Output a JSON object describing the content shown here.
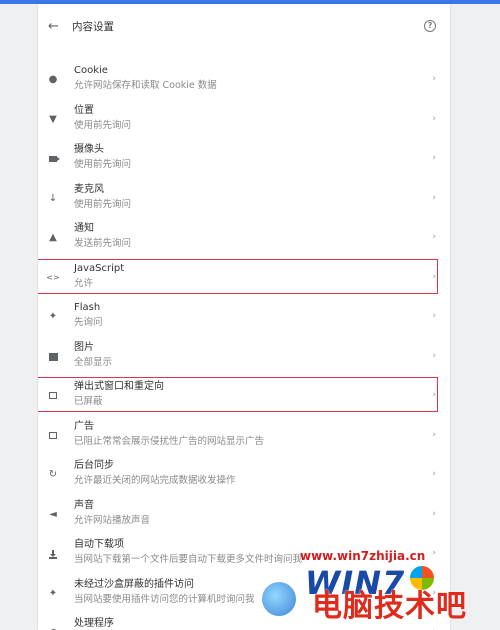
{
  "header": {
    "title": "内容设置",
    "back_icon": "arrow-left-icon",
    "help_icon": "help-circle-icon"
  },
  "items": [
    {
      "title": "Cookie",
      "sub": "允许网站保存和读取 Cookie 数据",
      "icon": "cookie-icon"
    },
    {
      "title": "位置",
      "sub": "使用前先询问",
      "icon": "location-icon"
    },
    {
      "title": "摄像头",
      "sub": "使用前先询问",
      "icon": "camera-icon"
    },
    {
      "title": "麦克风",
      "sub": "使用前先询问",
      "icon": "microphone-icon"
    },
    {
      "title": "通知",
      "sub": "发送前先询问",
      "icon": "bell-icon"
    },
    {
      "title": "JavaScript",
      "sub": "允许",
      "icon": "code-icon"
    },
    {
      "title": "Flash",
      "sub": "先询问",
      "icon": "puzzle-icon"
    },
    {
      "title": "图片",
      "sub": "全部显示",
      "icon": "image-icon"
    },
    {
      "title": "弹出式窗口和重定向",
      "sub": "已屏蔽",
      "icon": "open-in-new-icon"
    },
    {
      "title": "广告",
      "sub": "已阻止常常会展示侵扰性广告的网站显示广告",
      "icon": "ad-icon"
    },
    {
      "title": "后台同步",
      "sub": "允许最近关闭的网站完成数据收发操作",
      "icon": "sync-icon"
    },
    {
      "title": "声音",
      "sub": "允许网站播放声音",
      "icon": "volume-icon"
    },
    {
      "title": "自动下载项",
      "sub": "当网站下载第一个文件后要自动下载更多文件时询问我",
      "icon": "download-icon"
    },
    {
      "title": "未经过沙盒屏蔽的插件访问",
      "sub": "当网站要使用插件访问您的计算机时询问我",
      "icon": "puzzle-icon"
    },
    {
      "title": "处理程序",
      "sub": "",
      "icon": "handler-icon"
    }
  ],
  "chevron": "›",
  "watermark": {
    "url": "www.win7zhijia.cn",
    "logo": "WIN7",
    "brand": "电脑技术吧"
  }
}
